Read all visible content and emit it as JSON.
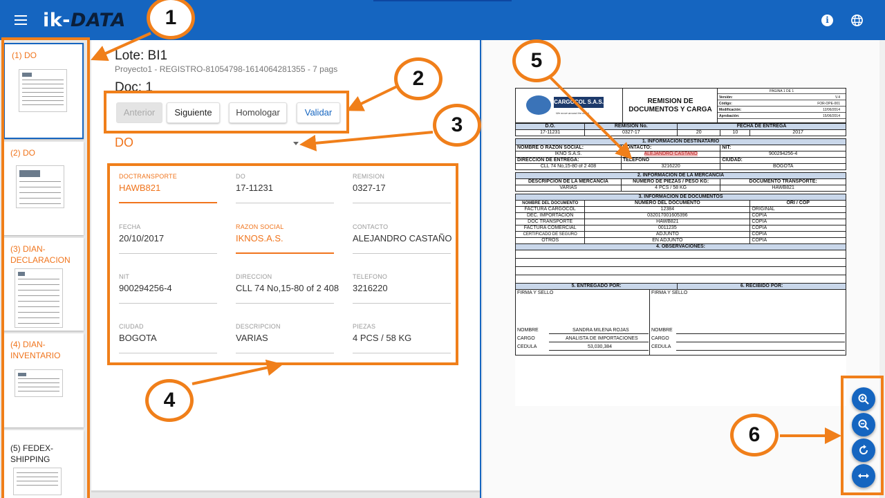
{
  "header": {
    "logo_ik": "ik",
    "logo_dash": "-",
    "logo_data": "DATA",
    "brand_color": "#1565c0"
  },
  "sidebar": {
    "items": [
      {
        "label": "(1) DO"
      },
      {
        "label": "(2) DO"
      },
      {
        "label": "(3) DIAN-DECLARACION"
      },
      {
        "label": "(4) DIAN-INVENTARIO"
      },
      {
        "label": "(5) FEDEX-SHIPPING"
      }
    ]
  },
  "main": {
    "lote_title": "Lote: BI1",
    "lote_sub": "Proyecto1 - REGISTRO-81054798-1614064281355 - 7 pags",
    "doc_title": "Doc: 1",
    "buttons": {
      "prev": "Anterior",
      "next": "Siguiente",
      "homologate": "Homologar",
      "validate": "Validar"
    },
    "doctype": "DO",
    "fields": [
      {
        "label": "DOCTRANSPORTE",
        "value": "HAWB821"
      },
      {
        "label": "DO",
        "value": "17-11231"
      },
      {
        "label": "REMISION",
        "value": "0327-17"
      },
      {
        "label": "FECHA",
        "value": "20/10/2017"
      },
      {
        "label": "RAZON SOCIAL",
        "value": "IKNOS.A.S."
      },
      {
        "label": "CONTACTO",
        "value": "ALEJANDRO CASTAÑO"
      },
      {
        "label": "NIT",
        "value": "900294256-4"
      },
      {
        "label": "DIRECCION",
        "value": "CLL 74 No,15-80 of 2 408"
      },
      {
        "label": "TELEFONO",
        "value": "3216220"
      },
      {
        "label": "CIUDAD",
        "value": "BOGOTA"
      },
      {
        "label": "DESCRIPCION",
        "value": "VARIAS"
      },
      {
        "label": "PIEZAS",
        "value": "4 PCS / 58 KG"
      }
    ]
  },
  "document": {
    "company": "CARGOCOL S.A.S.",
    "tagline": "We move around the world",
    "title_line1": "REMISION DE",
    "title_line2": "DOCUMENTOS Y CARGA",
    "page": "PÁGINA 1 DE 1",
    "meta": [
      {
        "k": "Versión:",
        "v": "V.4"
      },
      {
        "k": "Código:",
        "v": "FOR-OPE-001"
      },
      {
        "k": "Modificación:",
        "v": "12/06/2014"
      },
      {
        "k": "Aprobación:",
        "v": "15/06/2014"
      }
    ],
    "h_do": "D.O.",
    "h_remision": "REMISION No.",
    "h_fecha": "FECHA DE ENTREGA",
    "v_do": "17-11231",
    "v_remision": "0327-17",
    "v_day": "20",
    "v_month": "10",
    "v_year": "2017",
    "sec1": "1. INFORMACION DESTINATARIO",
    "l_nombre": "NOMBRE O RAZON SOCIAL:",
    "l_contacto": "CONTACTO:",
    "l_nit": "NIT:",
    "v_nombre": "IKNO S.A.S.",
    "v_contacto": "ALEJANDRO CASTAÑO",
    "v_nit": "900294256-4",
    "l_direccion": "DIRECCIÓN DE ENTREGA:",
    "l_telefono": "TELÉFONO",
    "l_ciudad": "CIUDAD:",
    "v_direccion": "CLL 74 No,15-80 of 2 408",
    "v_telefono": "3216220",
    "v_ciudad": "BOGOTA",
    "sec2": "2. INFORMACIÓN DE LA MERCANCÍA",
    "l_desc": "DESCRIPCIÓN DE LA MERCANCÍA",
    "l_piezas": "NÚMERO DE PIEZAS / PESO KG:",
    "l_doctrans": "DOCUMENTO TRANSPORTE:",
    "v_desc": "VARIAS",
    "v_piezas": "4 PCS / 58 KG",
    "v_doctrans": "HAWB821",
    "sec3": "3. INFORMACION DE DOCUMENTOS",
    "l_nombredoc": "NOMBRE DEL DOCUMENTO",
    "l_numdoc": "NÚMERO DEL DOCUMENTO",
    "l_ori": "ORI / COP",
    "docs": [
      {
        "name": "FACTURA CARGOCOL",
        "num": "12384",
        "type": "ORIGINAL"
      },
      {
        "name": "DEC. IMPORTACION",
        "num": "032017001605396",
        "type": "COPIA"
      },
      {
        "name": "DOC TRANSPORTE",
        "num": "HAWB821",
        "type": "COPIA"
      },
      {
        "name": "FACTURA COMERCIAL",
        "num": "0011235",
        "type": "COPIA"
      },
      {
        "name": "CERTIFICADO DE SEGURO",
        "num": "ADJUNTO",
        "type": "COPIA"
      },
      {
        "name": "OTROS",
        "num": "EN ADJUNTO",
        "type": "COPIA"
      }
    ],
    "sec4": "4. OBSERVACIONES:",
    "sec5": "5. ENTREGADO POR:",
    "sec6": "6. RECIBIDO POR:",
    "firma": "FIRMA Y SELLO",
    "l_nombre_s": "NOMBRE",
    "l_cargo": "CARGO",
    "l_cedula": "CEDULA",
    "v_nombre_s": "SANDRA MILENA ROJAS",
    "v_cargo": "ANALISTA DE IMPORTACIONES",
    "v_cedula": "53,030,384"
  },
  "annotations": [
    "1",
    "2",
    "3",
    "4",
    "5",
    "6"
  ],
  "colors": {
    "accent_orange": "#f07f1a",
    "label_orange": "#f0741c",
    "primary_blue": "#1565c0"
  }
}
